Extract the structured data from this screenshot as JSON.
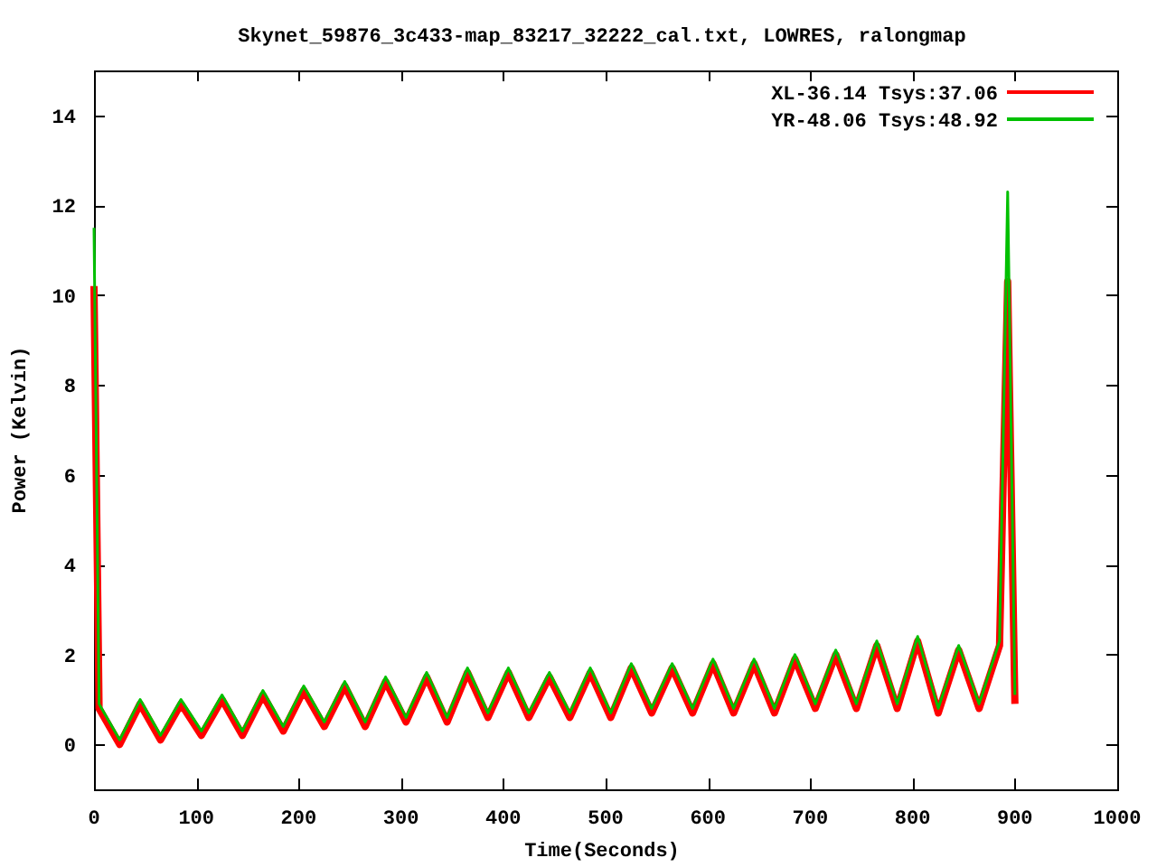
{
  "chart_data": {
    "type": "line",
    "title": "Skynet_59876_3c433-map_83217_32222_cal.txt, LOWRES, ralongmap",
    "xlabel": "Time(Seconds)",
    "ylabel": "Power (Kelvin)",
    "x": [
      0,
      5,
      25,
      45,
      65,
      85,
      105,
      125,
      145,
      165,
      185,
      205,
      225,
      245,
      265,
      285,
      305,
      325,
      345,
      365,
      385,
      405,
      425,
      445,
      465,
      485,
      505,
      525,
      545,
      565,
      585,
      605,
      625,
      645,
      665,
      685,
      705,
      725,
      745,
      765,
      785,
      805,
      825,
      845,
      865,
      885,
      893,
      900
    ],
    "series": [
      {
        "name": "XL-36.14 Tsys:37.06",
        "color": "#ff0000",
        "values": [
          10.2,
          0.8,
          0.0,
          0.9,
          0.1,
          0.9,
          0.2,
          1.0,
          0.2,
          1.1,
          0.3,
          1.2,
          0.4,
          1.3,
          0.4,
          1.4,
          0.5,
          1.5,
          0.5,
          1.6,
          0.6,
          1.6,
          0.6,
          1.5,
          0.6,
          1.6,
          0.6,
          1.7,
          0.7,
          1.7,
          0.7,
          1.8,
          0.7,
          1.8,
          0.7,
          1.9,
          0.8,
          2.0,
          0.8,
          2.2,
          0.8,
          2.3,
          0.7,
          2.1,
          0.8,
          2.2,
          10.3,
          0.9
        ]
      },
      {
        "name": "YR-48.06 Tsys:48.92",
        "color": "#00c000",
        "values": [
          11.5,
          0.9,
          0.1,
          1.0,
          0.2,
          1.0,
          0.3,
          1.1,
          0.3,
          1.2,
          0.4,
          1.3,
          0.5,
          1.4,
          0.5,
          1.5,
          0.6,
          1.6,
          0.6,
          1.7,
          0.7,
          1.7,
          0.7,
          1.6,
          0.7,
          1.7,
          0.7,
          1.8,
          0.8,
          1.8,
          0.8,
          1.9,
          0.8,
          1.9,
          0.8,
          2.0,
          0.9,
          2.1,
          0.9,
          2.3,
          0.9,
          2.4,
          0.8,
          2.2,
          0.9,
          2.3,
          12.3,
          1.1
        ]
      }
    ],
    "xlim": [
      0,
      1000
    ],
    "ylim": [
      -1,
      15
    ],
    "xticks": [
      0,
      100,
      200,
      300,
      400,
      500,
      600,
      700,
      800,
      900,
      1000
    ],
    "yticks": [
      0,
      2,
      4,
      6,
      8,
      10,
      12,
      14
    ],
    "legend": true
  }
}
